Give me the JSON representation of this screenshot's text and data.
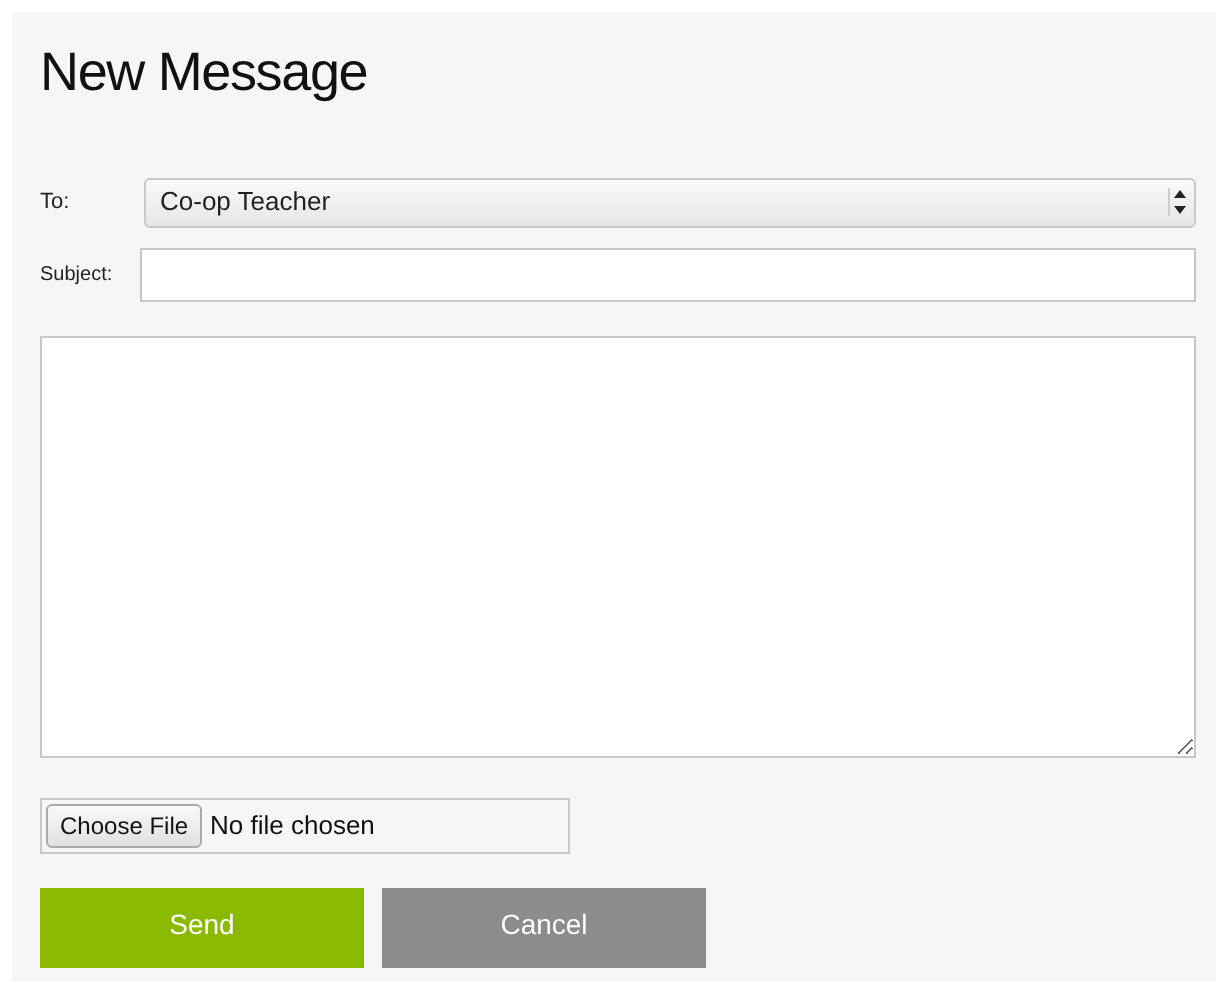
{
  "title": "New Message",
  "to": {
    "label": "To:",
    "value": "Co-op Teacher"
  },
  "subject": {
    "label": "Subject:"
  },
  "file": {
    "button": "Choose File",
    "status": "No file chosen"
  },
  "buttons": [
    {
      "kind": "primary",
      "label": "Send"
    },
    {
      "kind": "secondary",
      "label": "Cancel"
    }
  ]
}
